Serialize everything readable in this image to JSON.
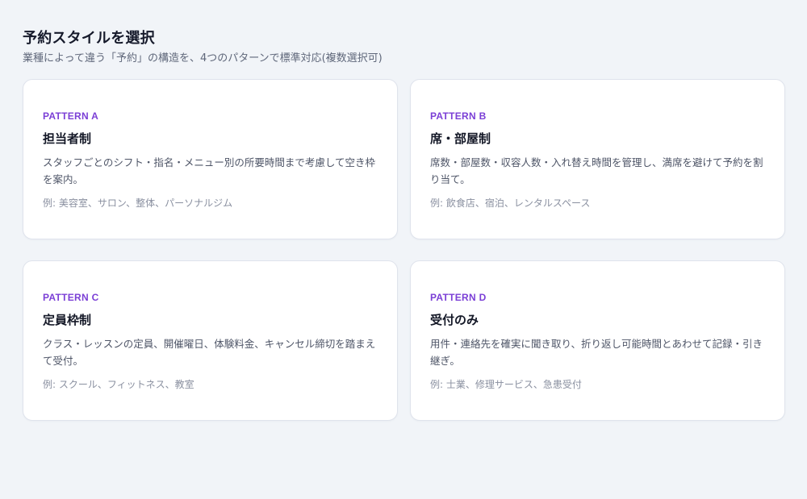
{
  "header": {
    "title": "予約スタイルを選択",
    "subtitle": "業種によって違う「予約」の構造を、4つのパターンで標準対応(複数選択可)"
  },
  "cards": [
    {
      "pattern": "PATTERN A",
      "title": "担当者制",
      "description": "スタッフごとのシフト・指名・メニュー別の所要時間まで考慮して空き枠を案内。",
      "example": "例: 美容室、サロン、整体、パーソナルジム"
    },
    {
      "pattern": "PATTERN B",
      "title": "席・部屋制",
      "description": "席数・部屋数・収容人数・入れ替え時間を管理し、満席を避けて予約を割り当て。",
      "example": "例: 飲食店、宿泊、レンタルスペース"
    },
    {
      "pattern": "PATTERN C",
      "title": "定員枠制",
      "description": "クラス・レッスンの定員、開催曜日、体験料金、キャンセル締切を踏まえて受付。",
      "example": "例: スクール、フィットネス、教室"
    },
    {
      "pattern": "PATTERN D",
      "title": "受付のみ",
      "description": "用件・連絡先を確実に聞き取り、折り返し可能時間とあわせて記録・引き継ぎ。",
      "example": "例: 士業、修理サービス、急患受付"
    }
  ],
  "colors": {
    "background": "#f1f4f8",
    "card": "#ffffff",
    "accent": "#7b3fd6",
    "title": "#141827",
    "body": "#4e5567",
    "muted": "#8a90a0"
  }
}
